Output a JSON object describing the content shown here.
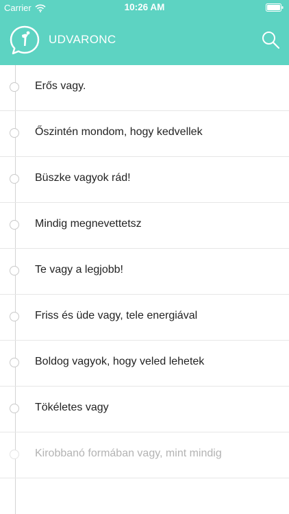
{
  "status_bar": {
    "carrier": "Carrier",
    "time": "10:26 AM"
  },
  "header": {
    "title": "UDVARONC",
    "accent_color": "#5dd3c2",
    "logo_icon": "speech-bubble-person-icon",
    "search_icon": "search-icon"
  },
  "list": {
    "items": [
      {
        "label": "Erős vagy."
      },
      {
        "label": "Őszintén mondom, hogy kedvellek"
      },
      {
        "label": "Büszke vagyok rád!"
      },
      {
        "label": "Mindig megnevettetsz"
      },
      {
        "label": "Te vagy a legjobb!"
      },
      {
        "label": "Friss és üde vagy, tele energiával"
      },
      {
        "label": "Boldog vagyok, hogy veled lehetek"
      },
      {
        "label": "Tökéletes vagy"
      },
      {
        "label": "Kirobbanó formában vagy, mint mindig"
      }
    ]
  }
}
